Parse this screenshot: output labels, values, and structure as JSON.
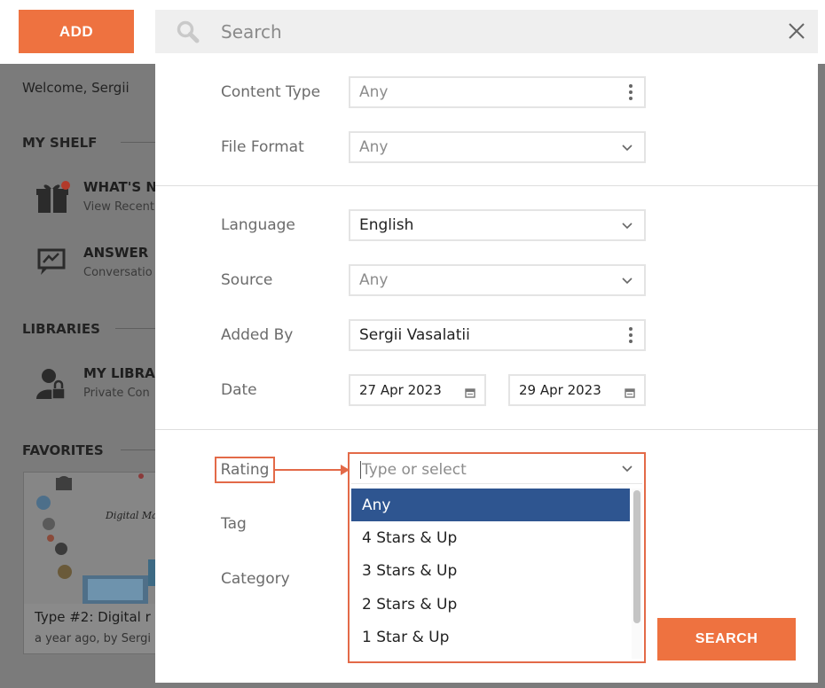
{
  "topbar": {
    "add_label": "ADD",
    "search_placeholder": "Search"
  },
  "background": {
    "welcome": "Welcome, Sergii",
    "my_shelf": {
      "title": "MY SHELF",
      "items": [
        {
          "title": "WHAT'S N",
          "subtitle": "View Recent",
          "icon": "gift-icon"
        },
        {
          "title": "ANSWER",
          "subtitle": "Conversatio",
          "icon": "chart-chat-icon"
        }
      ]
    },
    "libraries": {
      "title": "LIBRARIES",
      "items": [
        {
          "title": "MY LIBRA",
          "subtitle": "Private Con",
          "icon": "user-lock-icon"
        }
      ]
    },
    "favorites": {
      "title": "FAVORITES",
      "card": {
        "image_text": "Digital Marketing",
        "title": "Type #2: Digital r",
        "meta": "a year ago, by Sergi"
      }
    }
  },
  "filters": {
    "content_type": {
      "label": "Content Type",
      "value": "Any"
    },
    "file_format": {
      "label": "File Format",
      "value": "Any"
    },
    "language": {
      "label": "Language",
      "value": "English"
    },
    "source": {
      "label": "Source",
      "value": "Any"
    },
    "added_by": {
      "label": "Added By",
      "value": "Sergii Vasalatii"
    },
    "date": {
      "label": "Date",
      "from": "27 Apr 2023",
      "to": "29 Apr 2023"
    },
    "rating": {
      "label": "Rating",
      "placeholder": "Type or select",
      "options": [
        "Any",
        "4 Stars & Up",
        "3 Stars & Up",
        "2 Stars & Up",
        "1 Star & Up"
      ],
      "selected": "Any"
    },
    "tag": {
      "label": "Tag"
    },
    "category": {
      "label": "Category"
    }
  },
  "search_button": "SEARCH",
  "colors": {
    "accent": "#ee7240",
    "annotation": "#e36a48",
    "selected_option": "#2e5590",
    "overlay": "#7b7b7b"
  }
}
